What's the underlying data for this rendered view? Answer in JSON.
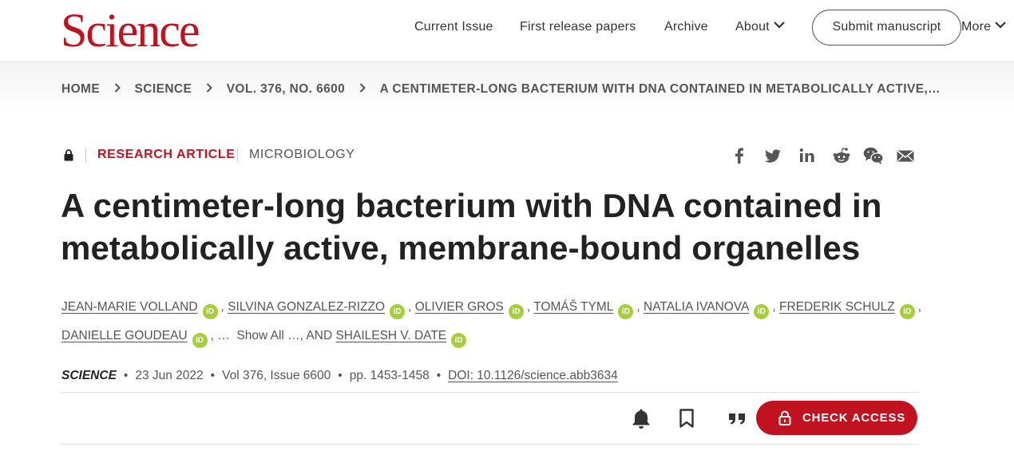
{
  "header": {
    "logo": "Science",
    "nav": {
      "current_issue": "Current Issue",
      "first_release": "First release papers",
      "archive": "Archive",
      "about": "About",
      "submit": "Submit manuscript",
      "more": "More"
    }
  },
  "breadcrumb": {
    "home": "HOME",
    "science": "SCIENCE",
    "volume": "VOL. 376, NO. 6600",
    "current": "A CENTIMETER-LONG BACTERIUM WITH DNA CONTAINED IN METABOLICALLY ACTIVE,…"
  },
  "article": {
    "type": "RESEARCH ARTICLE",
    "subject": "MICROBIOLOGY",
    "title": "A centimeter-long bacterium with DNA contained in metabolically active, membrane-bound organelles",
    "authors": [
      "JEAN-MARIE VOLLAND",
      "SILVINA GONZALEZ-RIZZO",
      "OLIVIER GROS",
      "TOMÁŠ TYML",
      "NATALIA IVANOVA",
      "FREDERIK SCHULZ",
      "DANIELLE GOUDEAU",
      "SHAILESH V. DATE"
    ],
    "orcid_label": "iD",
    "separators": {
      "comma": ",",
      "ellipsis": "…",
      "show_all": "Show All …",
      "and": ", AND"
    },
    "journal": "SCIENCE",
    "date": "23 Jun 2022",
    "volume": "Vol 376, Issue 6600",
    "pages": "pp. 1453-1458",
    "doi": "DOI: 10.1126/science.abb3634",
    "dot": "•"
  },
  "share": [
    "facebook-icon",
    "twitter-icon",
    "linkedin-icon",
    "reddit-icon",
    "wechat-icon",
    "email-icon"
  ],
  "actions": {
    "check_access": "CHECK ACCESS"
  },
  "colors": {
    "brand_red": "#c1121f",
    "orcid_green": "#a6ce39",
    "text": "#333333"
  }
}
